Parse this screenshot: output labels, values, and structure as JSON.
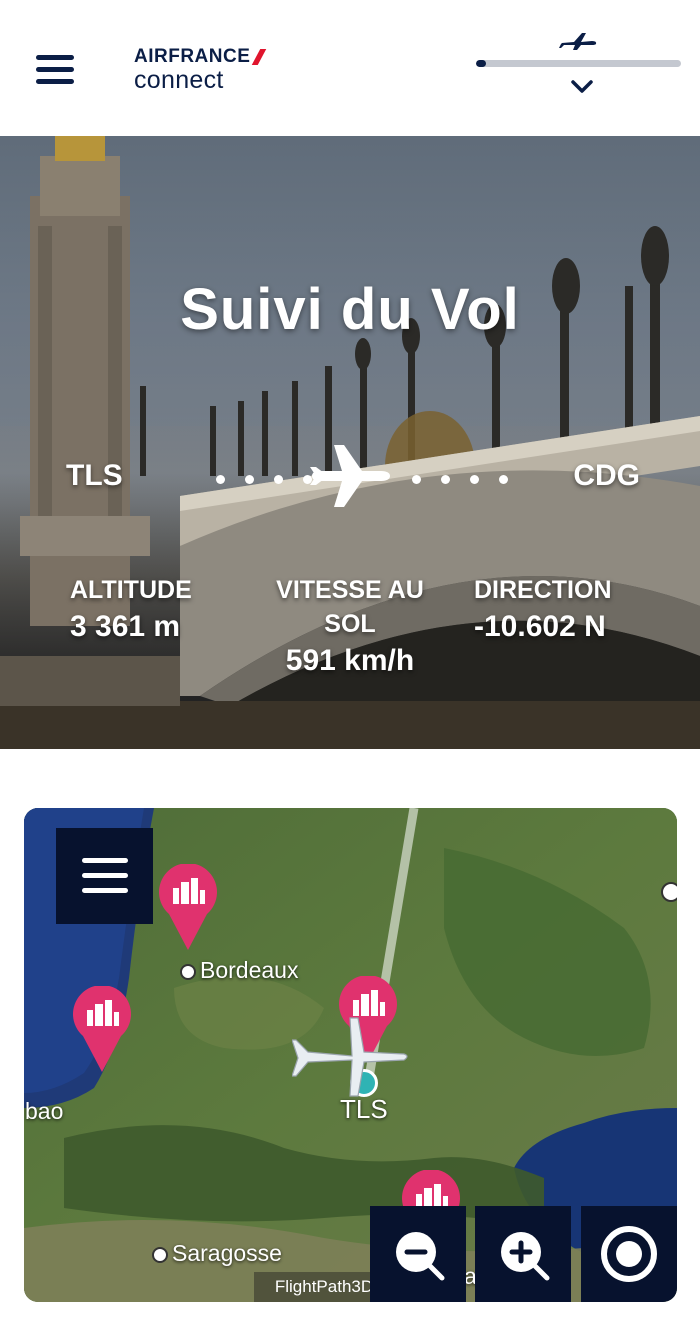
{
  "header": {
    "brand_name": "AIRFRANCE",
    "brand_sub": "connect",
    "flight_progress": 0.05
  },
  "hero": {
    "title": "Suivi du Vol",
    "origin": "TLS",
    "destination": "CDG",
    "stats": [
      {
        "label": "ALTITUDE",
        "value": "3 361 m"
      },
      {
        "label": "VITESSE AU SOL",
        "value": "591 km/h"
      },
      {
        "label": "DIRECTION",
        "value": "-10.602 N"
      }
    ]
  },
  "map": {
    "cities": [
      "Bordeaux",
      "bao",
      "Saragosse"
    ],
    "airport_label": "TLS",
    "attribution": "FlightPath3D",
    "partial_label": "a",
    "colors": {
      "pin": "#e0326e",
      "controls": "#07122e",
      "airport_dot": "#2fb3b4"
    }
  },
  "icons": {
    "menu": "hamburger-icon",
    "plane": "airplane-icon",
    "zoom_out": "zoom-out-icon",
    "zoom_in": "zoom-in-icon",
    "locate": "locate-icon",
    "poi": "city-poi-icon"
  }
}
